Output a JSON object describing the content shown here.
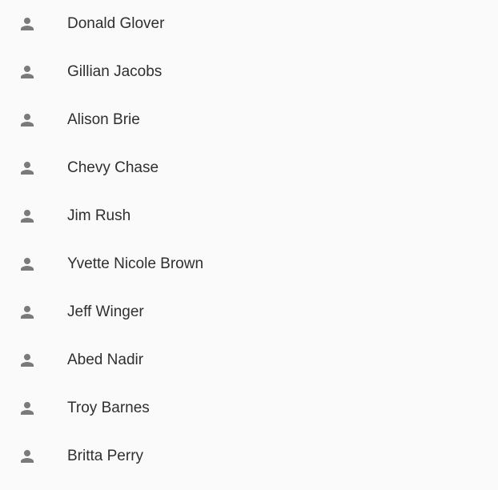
{
  "contacts": {
    "icon": "person-icon",
    "icon_color": "#7a7a7a",
    "items": [
      {
        "name": "Donald Glover"
      },
      {
        "name": "Gillian Jacobs"
      },
      {
        "name": "Alison Brie"
      },
      {
        "name": "Chevy Chase"
      },
      {
        "name": "Jim Rush"
      },
      {
        "name": "Yvette Nicole Brown"
      },
      {
        "name": "Jeff Winger"
      },
      {
        "name": "Abed Nadir"
      },
      {
        "name": "Troy Barnes"
      },
      {
        "name": "Britta Perry"
      }
    ]
  }
}
